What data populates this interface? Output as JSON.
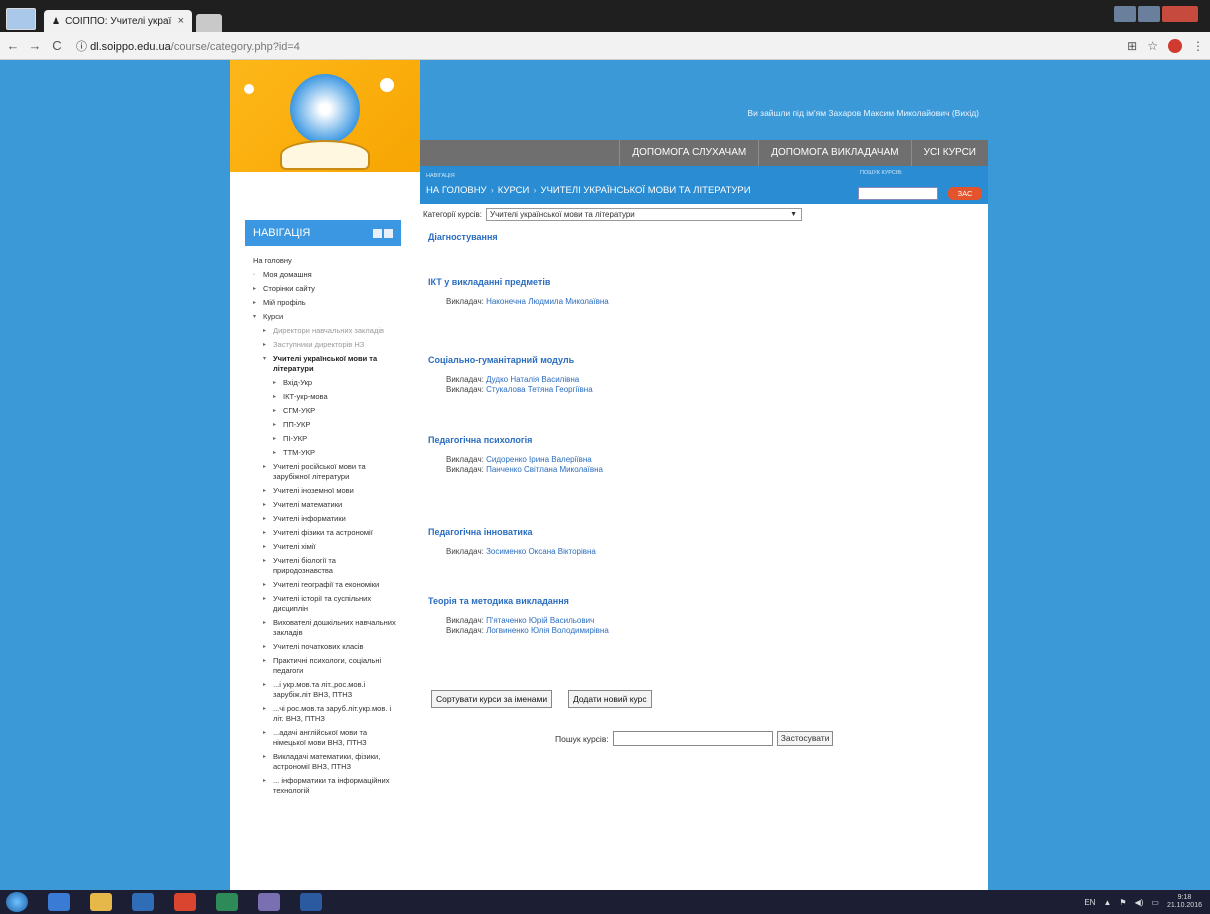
{
  "browser": {
    "tab_title": "СОІППО: Учителі украї",
    "tab_close": "×",
    "url_host": "dl.soippo.edu.ua",
    "url_path": "/course/category.php?id=4",
    "info_icon": "ⓘ"
  },
  "header": {
    "login_text": "Ви зайшли під ім'ям Захаров Максим Миколайович (Вихід)",
    "menu": [
      "ДОПОМОГА СЛУХАЧАМ",
      "ДОПОМОГА ВИКЛАДАЧАМ",
      "УСІ КУРСИ"
    ],
    "nav_label": "НАВІГАЦІЯ",
    "breadcrumbs": [
      "НА ГОЛОВНУ",
      "КУРСИ",
      "УЧИТЕЛІ УКРАЇНСЬКОЇ МОВИ ТА ЛІТЕРАТУРИ"
    ],
    "search_label": "ПОШУК КУРСІВ:",
    "search_button": "ЗАС"
  },
  "sidebar": {
    "title": "НАВІГАЦІЯ",
    "home": "На головну",
    "items": [
      {
        "label": "Моя домашня",
        "level": 1,
        "style": "normal",
        "arrow": "◦"
      },
      {
        "label": "Сторінки сайту",
        "level": 1,
        "style": "normal",
        "arrow": "▸"
      },
      {
        "label": "Мій профіль",
        "level": 1,
        "style": "normal",
        "arrow": "▸"
      },
      {
        "label": "Курси",
        "level": 1,
        "style": "normal",
        "arrow": "▾"
      },
      {
        "label": "Директори навчальних закладів",
        "level": 2,
        "style": "grey",
        "arrow": "▸"
      },
      {
        "label": "Заступники директорів НЗ",
        "level": 2,
        "style": "grey",
        "arrow": "▸"
      },
      {
        "label": "Учителі української мови та літератури",
        "level": 2,
        "style": "bold",
        "arrow": "▾"
      },
      {
        "label": "Вхід-Укр",
        "level": 3,
        "style": "normal",
        "arrow": "▸"
      },
      {
        "label": "ІКТ-укр-мова",
        "level": 3,
        "style": "normal",
        "arrow": "▸"
      },
      {
        "label": "СГМ-УКР",
        "level": 3,
        "style": "normal",
        "arrow": "▸"
      },
      {
        "label": "ПП-УКР",
        "level": 3,
        "style": "normal",
        "arrow": "▸"
      },
      {
        "label": "ПІ-УКР",
        "level": 3,
        "style": "normal",
        "arrow": "▸"
      },
      {
        "label": "ТТМ-УКР",
        "level": 3,
        "style": "normal",
        "arrow": "▸"
      },
      {
        "label": "Учителі російської мови та зарубіжної літератури",
        "level": 2,
        "style": "normal",
        "arrow": "▸"
      },
      {
        "label": "Учителі іноземної мови",
        "level": 2,
        "style": "normal",
        "arrow": "▸"
      },
      {
        "label": "Учителі математики",
        "level": 2,
        "style": "normal",
        "arrow": "▸"
      },
      {
        "label": "Учителі інформатики",
        "level": 2,
        "style": "normal",
        "arrow": "▸"
      },
      {
        "label": "Учителі фізики та астрономії",
        "level": 2,
        "style": "normal",
        "arrow": "▸"
      },
      {
        "label": "Учителі хімії",
        "level": 2,
        "style": "normal",
        "arrow": "▸"
      },
      {
        "label": "Учителі біології та природознавства",
        "level": 2,
        "style": "normal",
        "arrow": "▸"
      },
      {
        "label": "Учителі географії та економіки",
        "level": 2,
        "style": "normal",
        "arrow": "▸"
      },
      {
        "label": "Учителі історії та суспільних дисциплін",
        "level": 2,
        "style": "normal",
        "arrow": "▸"
      },
      {
        "label": "Вихователі дошкільних навчальних закладів",
        "level": 2,
        "style": "normal",
        "arrow": "▸"
      },
      {
        "label": "Учителі початкових класів",
        "level": 2,
        "style": "normal",
        "arrow": "▸"
      },
      {
        "label": "Практичні психологи, соціальні педагоги",
        "level": 2,
        "style": "normal",
        "arrow": "▸"
      },
      {
        "label": "...і укр.мов.та літ.,рос.мов.і зарубіж.літ ВНЗ, ПТНЗ",
        "level": 2,
        "style": "normal",
        "arrow": "▸"
      },
      {
        "label": "...чі рос.мов.та заруб.літ.укр.мов. і літ. ВНЗ, ПТНЗ",
        "level": 2,
        "style": "normal",
        "arrow": "▸"
      },
      {
        "label": "...адачі англійської мови та німецької мови ВНЗ, ПТНЗ",
        "level": 2,
        "style": "normal",
        "arrow": "▸"
      },
      {
        "label": "Викладачі математики, фізики, астрономії ВНЗ, ПТНЗ",
        "level": 2,
        "style": "normal",
        "arrow": "▸"
      },
      {
        "label": "... інформатики та інформаційних технологій",
        "level": 2,
        "style": "normal",
        "arrow": "▸"
      }
    ]
  },
  "content": {
    "category_label": "Категорії курсів:",
    "category_value": "Учителі української мови та літератури",
    "teacher_label": "Викладач:",
    "courses": [
      {
        "name": "Діагностування",
        "teachers": []
      },
      {
        "name": "ІКТ у викладанні предметів",
        "teachers": [
          "Наконечна Людмила Миколаївна"
        ]
      },
      {
        "name": "Соціально-гуманітарний модуль",
        "teachers": [
          "Дудко Наталія Василівна",
          "Стукалова Тетяна Георгіївна"
        ]
      },
      {
        "name": "Педагогічна психологія",
        "teachers": [
          "Сидоренко Ірина Валеріївна",
          "Панченко Світлана Миколаївна"
        ]
      },
      {
        "name": "Педагогічна інноватика",
        "teachers": [
          "Зосименко Оксана Вікторівна"
        ]
      },
      {
        "name": "Теорія та методика викладання",
        "teachers": [
          "П'ятаченко Юрій Васильович",
          "Логвиненко Юлія Володимирівна"
        ]
      }
    ],
    "sort_button": "Сортувати курси за іменами",
    "add_button": "Додати новий курс",
    "search_label": "Пошук курсів:",
    "apply_button": "Застосувати"
  },
  "taskbar": {
    "lang": "EN",
    "time": "9:18",
    "date": "21.10.2016"
  }
}
